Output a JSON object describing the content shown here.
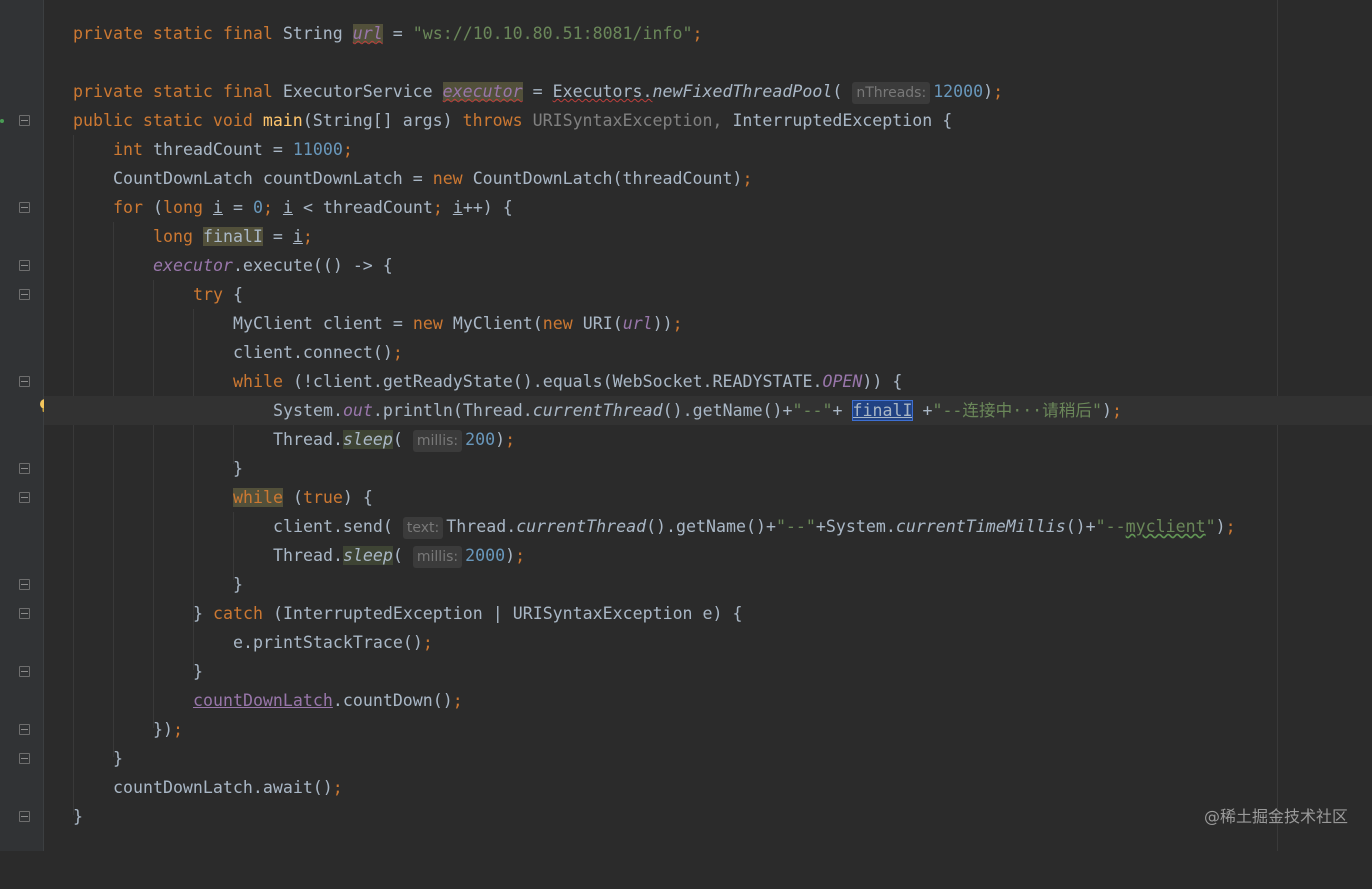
{
  "editor": {
    "lines": {
      "l1": {
        "kw": "private static final",
        "type": "String",
        "field": "url",
        "op": "=",
        "str": "\"ws://10.10.80.51:8081/info\"",
        "end": ";"
      },
      "l2": {
        "kw": "private static final",
        "type": "ExecutorService",
        "field": "executor",
        "op": "=",
        "cls": "Executors.",
        "method": "newFixedThreadPool",
        "open": "(",
        "hint": "nThreads:",
        "num": "12000",
        "close": ")",
        "end": ";"
      },
      "l3": {
        "kw": "public static void",
        "method": "main",
        "params": "(String[] args)",
        "throws": "throws",
        "ex1": "URISyntaxException,",
        "ex2": "InterruptedException {"
      },
      "l4": {
        "kw": "int",
        "name": "threadCount =",
        "num": "11000",
        "end": ";"
      },
      "l5": {
        "a": "CountDownLatch countDownLatch =",
        "kw": "new",
        "b": "CountDownLatch(threadCount)",
        "end": ";"
      },
      "l6": {
        "kw": "for",
        "p1": "(",
        "kw2": "long",
        "i1": "i",
        "eq": "=",
        "num": "0",
        "semi": ";",
        "i2": "i",
        "lt": "< threadCount",
        "semi2": ";",
        "i3": "i",
        "inc": "++) {"
      },
      "l7": {
        "kw": "long",
        "name": "finalI",
        "eq": "=",
        "val": "i",
        "end": ";"
      },
      "l8": {
        "field": "executor",
        "rest": ".execute(() -> {"
      },
      "l9": {
        "kw": "try",
        "rest": "{"
      },
      "l10": {
        "a": "MyClient client =",
        "kw": "new",
        "b": "MyClient(",
        "kw2": "new",
        "c": "URI(",
        "field": "url",
        "d": "))",
        "end": ";"
      },
      "l11": {
        "a": "client.connect()",
        "end": ";"
      },
      "l12": {
        "kw": "while",
        "a": "(!client.getReadyState().equals(WebSocket.READYSTATE.",
        "field": "OPEN",
        "b": ")) {"
      },
      "l13": {
        "a": "System.",
        "field": "out",
        "b": ".println(Thread.",
        "m": "currentThread",
        "c": "().getName()+",
        "s1": "\"--\"",
        "plus": "+",
        "sel": "finalI",
        "plus2": "+",
        "s2": "\"--连接中···请稍后\"",
        "d": ")",
        "end": ";"
      },
      "l14": {
        "a": "Thread.",
        "m": "sleep",
        "open": "(",
        "hint": "millis:",
        "num": "200",
        "close": ")",
        "end": ";"
      },
      "l15": {
        "a": "}"
      },
      "l16": {
        "kw": "while",
        "p": "(",
        "kw2": "true",
        "b": ") {"
      },
      "l17": {
        "a": "client.send(",
        "hint": "text:",
        "b": "Thread.",
        "m": "currentThread",
        "c": "().getName()+",
        "s1": "\"--\"",
        "d": "+System.",
        "m2": "currentTimeMillis",
        "e": "()+",
        "s2a": "\"--",
        "s2b": "myclient",
        "s2c": "\"",
        "f": ")",
        "end": ";"
      },
      "l18": {
        "a": "Thread.",
        "m": "sleep",
        "open": "(",
        "hint": "millis:",
        "num": "2000",
        "close": ")",
        "end": ";"
      },
      "l19": {
        "a": "}"
      },
      "l20": {
        "a": "}",
        "kw": "catch",
        "b": "(InterruptedException | URISyntaxException e) {"
      },
      "l21": {
        "a": "e.printStackTrace()",
        "end": ";"
      },
      "l22": {
        "a": "}"
      },
      "l23": {
        "field": "countDownLatch",
        "a": ".countDown()",
        "end": ";"
      },
      "l24": {
        "a": "})",
        "end": ";"
      },
      "l25": {
        "a": "}"
      },
      "l26": {
        "a": "countDownLatch.await()",
        "end": ";"
      },
      "l27": {
        "a": "}"
      }
    }
  },
  "watermark": "@稀土掘金技术社区",
  "colors": {
    "background": "#2b2b2b",
    "keyword": "#cc7832",
    "string": "#6a8759",
    "number": "#6897bb",
    "field": "#9876aa",
    "method": "#ffc66d",
    "text": "#a9b7c6"
  },
  "icons": [
    "intention-bulb-icon",
    "fold-marker-icon",
    "run-gutter-icon"
  ]
}
